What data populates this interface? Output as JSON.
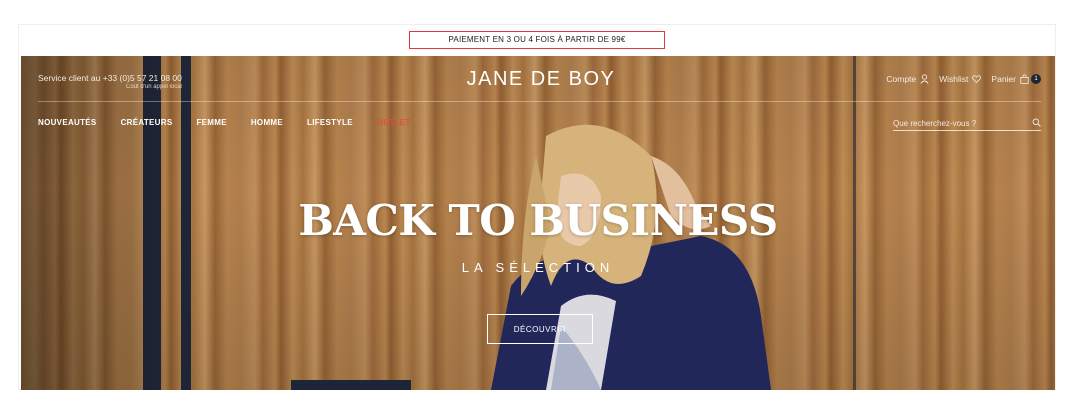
{
  "promo": {
    "text": "PAIEMENT EN 3 OU 4 FOIS À PARTIR DE 99€"
  },
  "header": {
    "service": "Service client au +33 (0)5 57 21 08 00",
    "service_sub": "Coût d'un appel local",
    "logo": "JANE DE BOY",
    "account_label": "Compte",
    "wishlist_label": "Wishlist",
    "cart_label": "Panier",
    "cart_count": "1"
  },
  "nav": {
    "items": [
      {
        "label": "NOUVEAUTÉS"
      },
      {
        "label": "CRÉATEURS"
      },
      {
        "label": "FEMME"
      },
      {
        "label": "HOMME"
      },
      {
        "label": "LIFESTYLE"
      },
      {
        "label": "OUTLET"
      }
    ]
  },
  "search": {
    "placeholder": "Que recherchez-vous ?"
  },
  "hero": {
    "title": "BACK TO BUSINESS",
    "subtitle": "LA SÉLECTION",
    "cta": "DÉCOUVRIR"
  },
  "icons": {
    "account": "user-icon",
    "wishlist": "heart-icon",
    "cart": "bag-icon",
    "search": "search-icon"
  },
  "colors": {
    "sale": "#e74c3c",
    "promo_border": "#e0383f",
    "dark_navy": "#1e2536"
  }
}
